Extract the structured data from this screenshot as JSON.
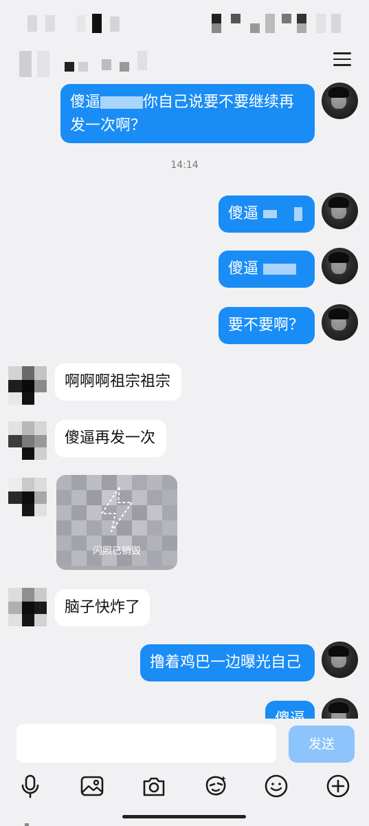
{
  "messages": {
    "m1_part1": "傻逼",
    "m1_part2": "你自己说要不要继续再",
    "m1_line2": "发一次啊？",
    "timestamp": "14:14",
    "m2": "傻逼",
    "m3": "傻逼",
    "m4": "要不要啊？",
    "l1": "啊啊啊祖宗祖宗",
    "l2": "傻逼再发一次",
    "flash": "闪照已销毁",
    "l3": "脑子快炸了",
    "m5": "撸着鸡巴一边曝光自己",
    "m6": "傻逼"
  },
  "composer": {
    "send_label": "发送",
    "input_value": ""
  },
  "toolbar": {
    "icons": [
      "mic-icon",
      "image-icon",
      "camera-icon",
      "sticker-icon",
      "emoji-icon",
      "plus-icon"
    ]
  },
  "colors": {
    "bubble_sent": "#1a8cf5",
    "bubble_received": "#ffffff",
    "background": "#f1f1f4",
    "send_button": "#8cc4fb"
  }
}
